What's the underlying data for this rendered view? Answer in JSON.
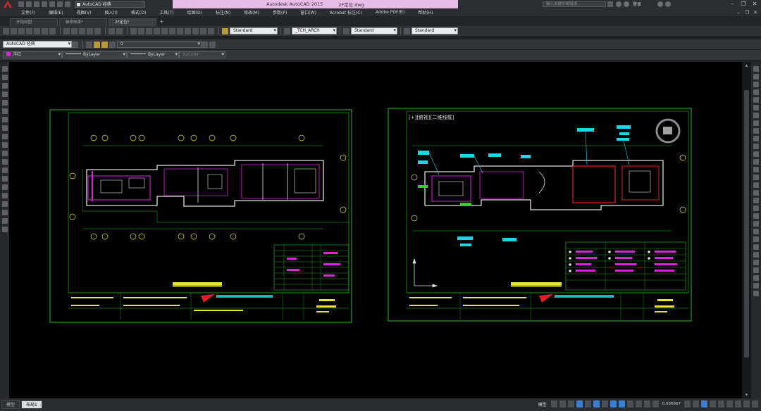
{
  "title": {
    "app_name": "Autodesk AutoCAD 2015",
    "file_name": "2F定位.dwg",
    "workspace": "AutoCAD 经典",
    "search_placeholder": "键入关键字或短语",
    "user_label": "登录"
  },
  "menu": [
    "文件(F)",
    "编辑(E)",
    "视图(V)",
    "插入(I)",
    "格式(O)",
    "工具(T)",
    "绘图(D)",
    "标注(N)",
    "修改(M)",
    "参数(P)",
    "窗口(W)",
    "Acrobat 标注(C)",
    "Adobe PDF(B)",
    "帮助(H)"
  ],
  "tabs": [
    {
      "label": "开始绘图"
    },
    {
      "label": "装修效果*"
    },
    {
      "label": "2F定位*"
    }
  ],
  "toolbar": {
    "text_style": "Standard",
    "dim_style": "_TCH_ARCH",
    "table_style": "Standard",
    "mleader_style": "Standard",
    "workspace_combo": "AutoCAD 经典",
    "layer_combo": "0",
    "color_combo": "洋红",
    "linetype_combo": "ByLayer",
    "lineweight_combo": "ByLayer",
    "plotstyle_combo": "ByColor"
  },
  "drawing": {
    "sheet2_title": "[+][俯视][二维线框]",
    "colors": {
      "frame": "#20c020",
      "wall": "#e0e0e0",
      "magenta": "#e11fe1",
      "yellow": "#e6e62a",
      "cyan": "#18d8e8",
      "red": "#e02020",
      "green": "#23d823"
    }
  },
  "status": {
    "layout_tabs": [
      "模型",
      "布局1"
    ],
    "mode": "模型",
    "scale": "0.036667"
  }
}
